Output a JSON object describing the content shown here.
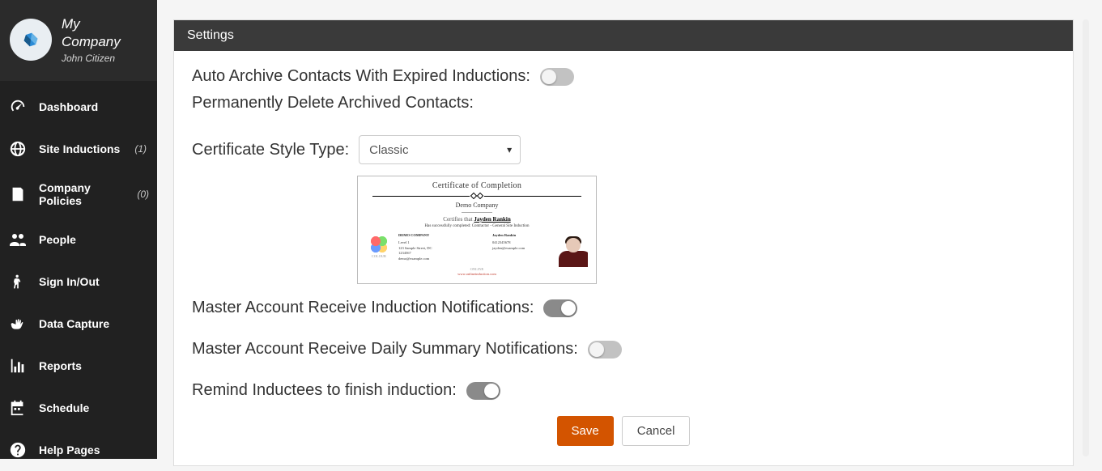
{
  "header": {
    "company_name_line1": "My",
    "company_name_line2": "Company",
    "user_name": "John Citizen"
  },
  "nav": {
    "dashboard": "Dashboard",
    "site_inductions": "Site Inductions",
    "site_inductions_count": "(1)",
    "company_policies": "Company Policies",
    "company_policies_count": "(0)",
    "people": "People",
    "sign_in_out": "Sign In/Out",
    "data_capture": "Data Capture",
    "reports": "Reports",
    "schedule": "Schedule",
    "help_pages": "Help Pages"
  },
  "panel": {
    "title": "Settings"
  },
  "settings": {
    "auto_archive_label": "Auto Archive Contacts With Expired Inductions:",
    "auto_archive_on": false,
    "perm_delete_label": "Permanently Delete Archived Contacts:",
    "cert_style_label": "Certificate Style Type:",
    "cert_style_value": "Classic",
    "master_induction_label": "Master Account Receive Induction Notifications:",
    "master_induction_on": true,
    "master_daily_label": "Master Account Receive Daily Summary Notifications:",
    "master_daily_on": false,
    "remind_inductees_label": "Remind Inductees to finish induction:",
    "remind_inductees_on": true
  },
  "certificate_preview": {
    "title": "Certificate of Completion",
    "company": "Demo Company",
    "certifies_prefix": "Certifies that",
    "certifies_name": "Jayden Rankin",
    "description_prefix": "Has successfully completed:",
    "description_course": "Contractor - General Site Induction",
    "left_heading": "Demo Company",
    "left_lines": "Level 1\n123 Sample Street, DC\n1234567\ndemo@example.com",
    "right_heading": "Jayden Rankin",
    "right_lines": "0412345678\njayden@example.com",
    "logo_label": "COLOUR",
    "bottom_note": "ONLINE",
    "link_text": "www.onlineinduction.com"
  },
  "actions": {
    "save": "Save",
    "cancel": "Cancel"
  }
}
